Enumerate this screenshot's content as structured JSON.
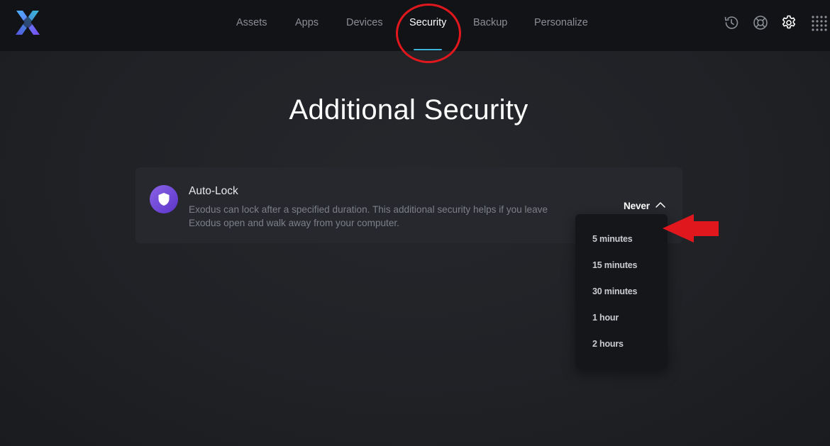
{
  "header": {
    "tabs": [
      {
        "label": "Assets"
      },
      {
        "label": "Apps"
      },
      {
        "label": "Devices"
      },
      {
        "label": "Security"
      },
      {
        "label": "Backup"
      },
      {
        "label": "Personalize"
      }
    ],
    "active_tab": "Security",
    "icons": [
      "history-icon",
      "support-icon",
      "settings-icon",
      "apps-grid-icon"
    ]
  },
  "main": {
    "title": "Additional Security",
    "card": {
      "icon": "shield-icon",
      "title": "Auto-Lock",
      "description": "Exodus can lock after a specified duration. This additional security helps if you leave Exodus open and walk away from your computer.",
      "selected_value": "Never"
    },
    "dropdown": {
      "options": [
        "5 minutes",
        "15 minutes",
        "30 minutes",
        "1 hour",
        "2 hours"
      ]
    }
  },
  "colors": {
    "accent_underline": "#3fb6d9",
    "annotation_red": "#e0181e",
    "shield_purple": "#7a52dd"
  }
}
